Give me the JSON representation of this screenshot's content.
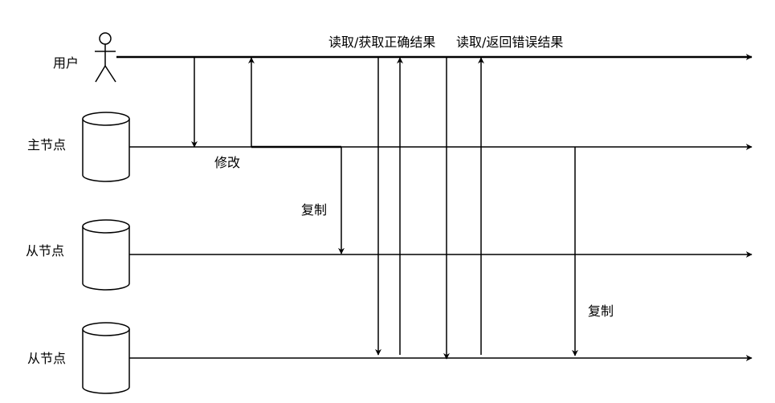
{
  "lanes": {
    "user": "用户",
    "master": "主节点",
    "slave1": "从节点",
    "slave2": "从节点"
  },
  "messages": {
    "modify": "修改",
    "replicate1": "复制",
    "replicate2": "复制",
    "read_correct": "读取/获取正确结果",
    "read_error": "读取/返回错误结果"
  }
}
